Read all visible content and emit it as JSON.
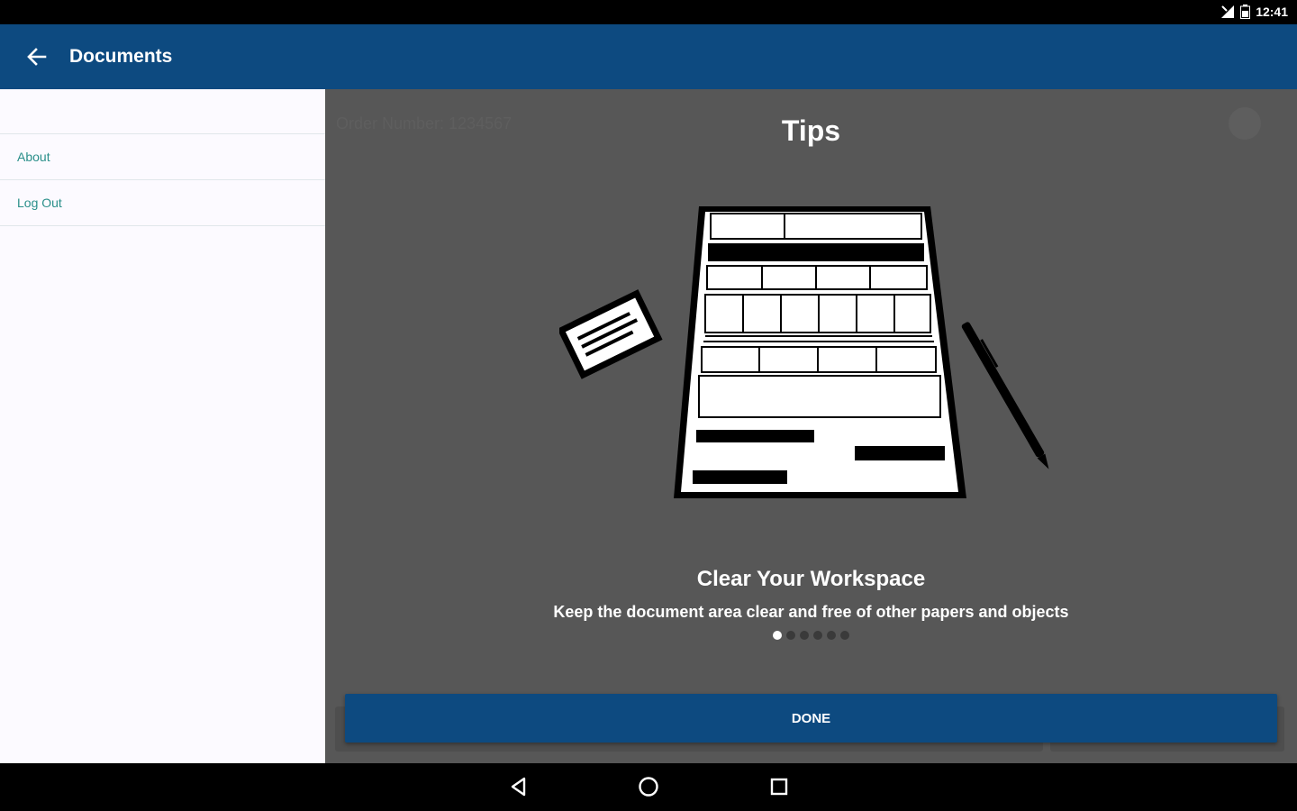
{
  "status_bar": {
    "time": "12:41",
    "icons": [
      "signal-icon",
      "battery-icon"
    ]
  },
  "app_bar": {
    "title": "Documents",
    "back_icon": "arrow-left-icon"
  },
  "drawer": {
    "items": [
      {
        "label": "About"
      },
      {
        "label": "Log Out"
      }
    ]
  },
  "background_content": {
    "order_label": "Order Number: 1234567",
    "help_icon": "help-icon"
  },
  "tips": {
    "title": "Tips",
    "illustration": "document-workspace-illustration",
    "heading": "Clear Your Workspace",
    "body": "Keep the document area clear and free of other papers and objects",
    "pager": {
      "total": 6,
      "active_index": 0
    },
    "done_label": "DONE"
  },
  "nav_bar": {
    "buttons": [
      "back-triangle-icon",
      "home-circle-icon",
      "recents-square-icon"
    ]
  },
  "colors": {
    "primary": "#0d4a80",
    "overlay": "#575757",
    "drawer_bg": "#fcfaff",
    "drawer_text": "#2a8f8a"
  }
}
